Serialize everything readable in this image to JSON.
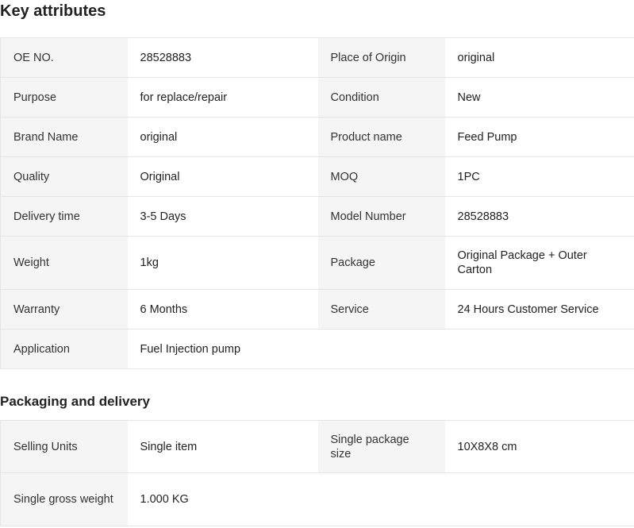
{
  "key_attributes": {
    "title": "Key attributes",
    "rows": [
      [
        {
          "k": "OE NO.",
          "v": "28528883"
        },
        {
          "k": "Place of Origin",
          "v": "original"
        }
      ],
      [
        {
          "k": "Purpose",
          "v": "for replace/repair"
        },
        {
          "k": "Condition",
          "v": "New"
        }
      ],
      [
        {
          "k": "Brand Name",
          "v": "original"
        },
        {
          "k": "Product name",
          "v": "Feed Pump"
        }
      ],
      [
        {
          "k": "Quality",
          "v": "Original"
        },
        {
          "k": "MOQ",
          "v": "1PC"
        }
      ],
      [
        {
          "k": "Delivery time",
          "v": "3-5 Days"
        },
        {
          "k": "Model Number",
          "v": "28528883"
        }
      ],
      [
        {
          "k": "Weight",
          "v": "1kg"
        },
        {
          "k": "Package",
          "v": "Original Package + Outer Carton"
        }
      ],
      [
        {
          "k": "Warranty",
          "v": "6 Months"
        },
        {
          "k": "Service",
          "v": "24 Hours Customer Service"
        }
      ],
      [
        {
          "k": "Application",
          "v": "Fuel Injection pump"
        },
        {
          "k": "",
          "v": ""
        }
      ]
    ]
  },
  "packaging": {
    "title": "Packaging and delivery",
    "rows": [
      [
        {
          "k": "Selling Units",
          "v": "Single item"
        },
        {
          "k": "Single package size",
          "v": "10X8X8 cm"
        }
      ],
      [
        {
          "k": "Single gross weight",
          "v": "1.000 KG"
        },
        {
          "k": "",
          "v": ""
        }
      ]
    ]
  }
}
